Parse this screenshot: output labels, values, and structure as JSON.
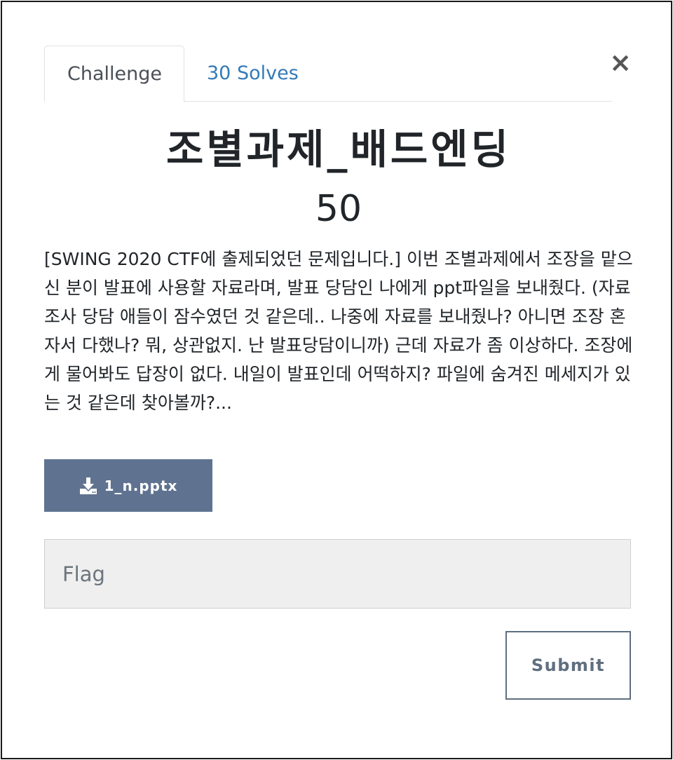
{
  "tabs": [
    {
      "label": "Challenge",
      "active": true
    },
    {
      "label": "30 Solves",
      "active": false
    }
  ],
  "close_label": "×",
  "challenge": {
    "title": "조별과제_배드엔딩",
    "points": "50",
    "description": "[SWING 2020 CTF에 출제되었던 문제입니다.] 이번 조별과제에서 조장을 맡으신 분이 발표에 사용할 자료라며, 발표 당담인 나에게 ppt파일을 보내줬다. (자료 조사 당담 애들이 잠수였던 것 같은데.. 나중에 자료를 보내줬나? 아니면 조장 혼자서 다했나? 뭐, 상관없지. 난 발표당담이니까) 근데 자료가 좀 이상하다. 조장에게 물어봐도 답장이 없다. 내일이 발표인데 어떡하지? 파일에 숨겨진 메세지가 있는 것 같은데 찾아볼까?..."
  },
  "file": {
    "name": "1_n.pptx",
    "icon": "download-icon"
  },
  "flag_input": {
    "placeholder": "Flag",
    "value": ""
  },
  "submit_label": "Submit",
  "colors": {
    "tab_link": "#337ab7",
    "download_button": "#5f7290",
    "submit_border": "#5f6f7f",
    "input_background": "#efefef"
  }
}
